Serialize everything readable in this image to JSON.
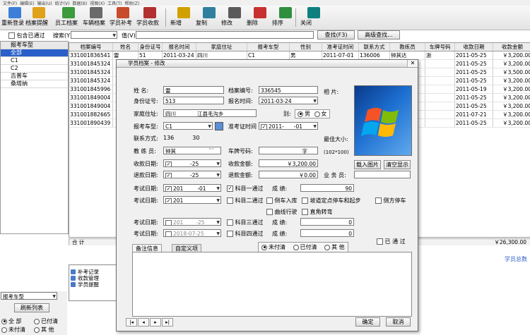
{
  "menu": [
    "文件(F)",
    "编辑(E)",
    "输出(U)",
    "统计(V)",
    "数据(B)",
    "视图(X)",
    "工具(T)",
    "帮助(Z)"
  ],
  "toolbar": [
    {
      "label": "重新登录",
      "icon": "relogin-icon",
      "color": "#3b7fd8"
    },
    {
      "label": "档案提醒",
      "icon": "reminder-icon",
      "color": "#e0a21b"
    },
    {
      "label": "员工档案",
      "icon": "staff-icon",
      "color": "#3c9b3c"
    },
    {
      "label": "车辆档案",
      "icon": "car-icon",
      "color": "#6a6a6a"
    },
    {
      "label": "学员补考",
      "icon": "retest-icon",
      "color": "#c84b2b"
    },
    {
      "label": "学员收款",
      "icon": "payment-icon",
      "color": "#b23030"
    },
    {
      "label": "新增",
      "icon": "add-icon",
      "color": "#d1a000"
    },
    {
      "label": "复制",
      "icon": "copy-icon",
      "color": "#2f7f9f"
    },
    {
      "label": "修改",
      "icon": "edit-icon",
      "color": "#5a5a5a"
    },
    {
      "label": "删除",
      "icon": "delete-icon",
      "color": "#c83030"
    },
    {
      "label": "排序",
      "icon": "sort-icon",
      "color": "#2f8f3f"
    },
    {
      "label": "关闭",
      "icon": "exit-icon",
      "color": "#0f7f7f"
    }
  ],
  "filter": {
    "include_passed": "包含已通过",
    "search_label": "搜索(Y)",
    "value_label": "值(V)",
    "search_btn": "查找(F3)",
    "advanced_btn": "高级查找..."
  },
  "tree": {
    "header": "报考车型",
    "items": [
      "全部",
      "C1",
      "C2",
      "吉普车",
      "桑塔纳"
    ]
  },
  "grid": {
    "columns": [
      "档案编号",
      "姓名",
      "身份证号",
      "报名时间",
      "家庭住址",
      "报考车型",
      "性别",
      "准考证时间",
      "联系方式",
      "教练员",
      "车牌号码",
      "收款日期",
      "收款金额"
    ],
    "rows": [
      [
        "331001836541",
        "雷",
        "51",
        "2011-03-24",
        "四川",
        "C1",
        "男",
        "2011-07-01",
        "136006",
        "钟其达",
        "浙",
        "2011-05-25",
        "￥3,200.00"
      ],
      [
        "331001845324",
        "",
        "",
        "",
        "",
        "",
        "",
        "",
        "",
        "",
        "",
        "2011-05-25",
        "￥3,200.00"
      ],
      [
        "331001845324",
        "",
        "",
        "",
        "",
        "",
        "",
        "",
        "",
        "",
        "",
        "2011-05-25",
        "￥3,500.00"
      ],
      [
        "331001845324",
        "",
        "",
        "",
        "",
        "",
        "",
        "",
        "",
        "",
        "",
        "2011-05-25",
        "￥3,200.00"
      ],
      [
        "331001845996",
        "",
        "",
        "",
        "",
        "",
        "",
        "",
        "",
        "",
        "",
        "2011-05-19",
        "￥3,200.00"
      ],
      [
        "331001849004",
        "",
        "",
        "",
        "",
        "",
        "",
        "",
        "",
        "",
        "",
        "2011-05-25",
        "￥3,200.00"
      ],
      [
        "331001849004",
        "",
        "",
        "",
        "",
        "",
        "",
        "",
        "",
        "",
        "",
        "2011-05-25",
        "￥3,200.00"
      ],
      [
        "331001882665",
        "",
        "",
        "",
        "",
        "",
        "",
        "",
        "",
        "",
        "",
        "2011-07-21",
        "￥3,200.00"
      ],
      [
        "331001890439",
        "",
        "",
        "",
        "",
        "",
        "",
        "",
        "",
        "",
        "",
        "2011-05-25",
        "￥3,200.00"
      ]
    ],
    "sum_label": "合 计",
    "sum_value": "￥26,300.00",
    "total_label": "学员总数"
  },
  "nav": [
    "补考记录",
    "收款管理",
    "学员提醒"
  ],
  "bottom": {
    "combo": "报考车型",
    "refresh": "刷新列表",
    "radios": [
      "全 部",
      "已付清",
      "未付清",
      "其 他"
    ]
  },
  "dialog": {
    "title": "学员档案 - 修改",
    "name_label": "姓    名:",
    "name_value": "雷",
    "file_no_label": "档案编号:",
    "file_no_value": "336545",
    "photo_label": "相   片:",
    "id_label": "身份证号:",
    "id_value": "513",
    "reg_time_label": "报名时间:",
    "reg_time_value": "2011-03-24",
    "addr_label": "家庭住址:",
    "addr_value": "四川",
    "addr_value2": "江县毛沟乡",
    "gender_label": "别:",
    "gender_male": "男",
    "gender_female": "女",
    "cartype_label": "报考车型:",
    "cartype_value": "C1",
    "admission_label": "准考证时间",
    "admission_value": "2011-",
    "admission_value2": "-01",
    "contact_label": "联系方式:",
    "contact_value": "136",
    "contact_value2": "30",
    "max_size": "最佳大小:",
    "max_size2": "(102*100)",
    "coach_label": "教 练 员:",
    "coach_value": "钟其",
    "plate_label": "车牌号码:",
    "plate_value": "字",
    "load_photo": "载入图片",
    "clear_photo": "清空显示",
    "pay_date_label": "收款日期:",
    "pay_date_value": "-25",
    "pay_amt_label": "收款金额:",
    "pay_amt_value": "￥3,200.00",
    "refund_date_label": "退款日期:",
    "refund_date_value": "-25",
    "refund_amt_label": "退款金额:",
    "refund_amt_value": "￥0.00",
    "salesman_label": "业 务 员:",
    "exam_date_label": "考试日期:",
    "exam1_date": "201",
    "exam1_date2": "-01",
    "subj1": "科目一通过",
    "score_label": "成    绩:",
    "score1": "90",
    "exam2_date": "201",
    "subj2": "科目二通过",
    "opt_reverse": "倒车入库",
    "opt_hill": "坡道定点停车和起步",
    "opt_side": "侧方停车",
    "opt_curve": "曲线行驶",
    "opt_right": "直角转弯",
    "score2": "0",
    "exam3_date": "201",
    "exam3_date2": "-25",
    "subj3": "科目三通过",
    "score3": "0",
    "exam4_date": "2018-07-25",
    "subj4": "科目四通过",
    "score4": "0",
    "passed": "已 通 过",
    "tab_notes": "备注信息",
    "tab_custom": "自定义项",
    "pay_unpaid": "未付清",
    "pay_paid": "已付清",
    "pay_other": "其  他",
    "ok": "确定",
    "cancel": "取消"
  }
}
